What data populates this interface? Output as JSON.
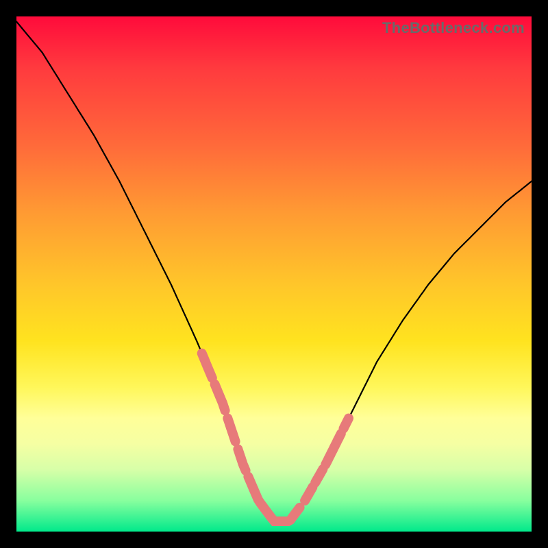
{
  "attribution": "TheBottleneck.com",
  "chart_data": {
    "type": "line",
    "title": "",
    "xlabel": "",
    "ylabel": "",
    "ylim": [
      0,
      100
    ],
    "xlim": [
      0,
      100
    ],
    "series": [
      {
        "name": "bottleneck-curve",
        "x": [
          0,
          5,
          10,
          15,
          20,
          25,
          30,
          35,
          40,
          44,
          47,
          50,
          53,
          56,
          60,
          65,
          70,
          75,
          80,
          85,
          90,
          95,
          100
        ],
        "values": [
          99,
          93,
          85,
          77,
          68,
          58,
          48,
          37,
          25,
          13,
          6,
          2,
          2,
          6,
          13,
          23,
          33,
          41,
          48,
          54,
          59,
          64,
          68
        ]
      }
    ],
    "annotations": [
      {
        "name": "bead-flat-bottom",
        "x_start": 46,
        "x_end": 55
      },
      {
        "name": "bead-left-1",
        "x_start": 36,
        "x_end": 38
      },
      {
        "name": "bead-left-2",
        "x_start": 38.5,
        "x_end": 40.5
      },
      {
        "name": "bead-left-3",
        "x_start": 41,
        "x_end": 42.5
      },
      {
        "name": "bead-left-4",
        "x_start": 43,
        "x_end": 44.5
      },
      {
        "name": "bead-left-5",
        "x_start": 45,
        "x_end": 46
      },
      {
        "name": "bead-right-1",
        "x_start": 56,
        "x_end": 57.5
      },
      {
        "name": "bead-right-2",
        "x_start": 58,
        "x_end": 59.5
      },
      {
        "name": "bead-right-3",
        "x_start": 60,
        "x_end": 63
      },
      {
        "name": "bead-right-4",
        "x_start": 63.5,
        "x_end": 64.5
      }
    ]
  }
}
